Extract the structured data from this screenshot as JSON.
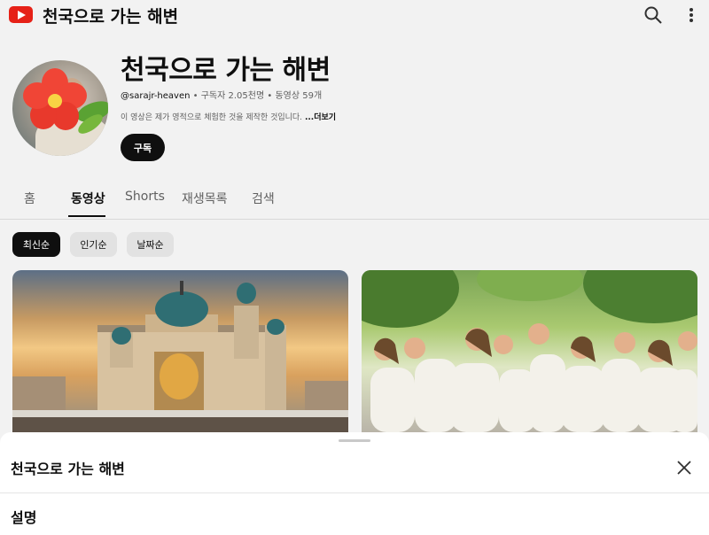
{
  "topbar": {
    "logo_icon": "youtube-logo-icon",
    "title": "천국으로 가는 해변",
    "search_icon": "search-icon",
    "more_icon": "more-vert-icon"
  },
  "channel": {
    "name": "천국으로 가는 해변",
    "handle": "@sarajr-heaven",
    "subscribers": "구독자 2.05천명",
    "videos": "동영상 59개",
    "description": "이 영상은  제가 영적으로 체험한 것을 제작한 것입니다.",
    "more_label": "...더보기",
    "subscribe_label": "구독"
  },
  "tabs": [
    {
      "label": "홈",
      "active": false
    },
    {
      "label": "동영상",
      "active": true
    },
    {
      "label": "Shorts",
      "active": false
    },
    {
      "label": "재생목록",
      "active": false
    },
    {
      "label": "검색",
      "active": false
    }
  ],
  "chips": [
    {
      "label": "최신순",
      "active": true
    },
    {
      "label": "인기순",
      "active": false
    },
    {
      "label": "날짜순",
      "active": false
    }
  ],
  "sheet": {
    "title": "천국으로 가는 해변",
    "close_icon": "close-icon",
    "section_title": "설명"
  },
  "colors": {
    "youtube_red": "#e62117",
    "text_primary": "#0f0f0f",
    "text_secondary": "#606060"
  }
}
